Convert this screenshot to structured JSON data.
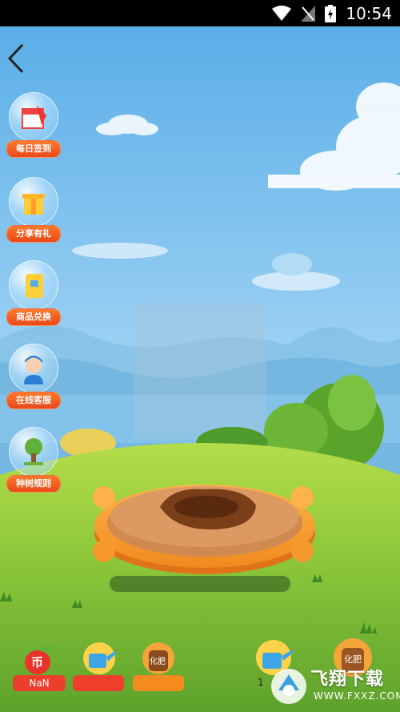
{
  "status_bar": {
    "time": "10:54"
  },
  "side_menu": [
    {
      "label": "每日签到",
      "icon": "calendar-icon"
    },
    {
      "label": "分享有礼",
      "icon": "gift-icon"
    },
    {
      "label": "商品兑换",
      "icon": "voucher-icon"
    },
    {
      "label": "在线客服",
      "icon": "support-agent-icon"
    },
    {
      "label": "种树规则",
      "icon": "tree-icon"
    }
  ],
  "bottom_bar": {
    "coin_icon_text": "币",
    "coin_value": "NaN",
    "fertilizer_text": "化肥",
    "watering_count_partial": "1"
  },
  "watermark": {
    "title": "飞翔下载",
    "url": "WWW.FXXZ.COM"
  },
  "colors": {
    "accent": "#f25a20",
    "sky": "#6fb7ea",
    "grass": "#8fcf3a"
  }
}
